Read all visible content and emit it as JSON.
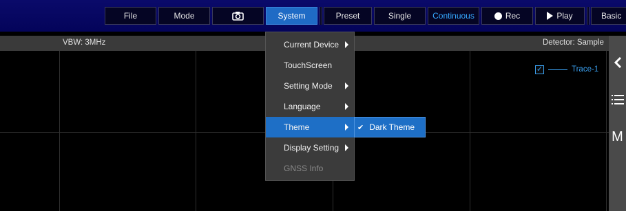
{
  "toolbar": {
    "file": "File",
    "mode": "Mode",
    "camera_icon": "camera-icon",
    "system": "System",
    "preset": "Preset",
    "single": "Single",
    "continuous": "Continuous",
    "rec": "Rec",
    "play": "Play",
    "basic": "Basic"
  },
  "status": {
    "vbw": "VBW: 3MHz",
    "detector": "Detector: Sample"
  },
  "legend": {
    "checked": true,
    "label": "Trace-1",
    "color": "#3aa0f0"
  },
  "menu": {
    "items": [
      {
        "label": "Current Device",
        "has_submenu": true
      },
      {
        "label": "TouchScreen",
        "has_submenu": false
      },
      {
        "label": "Setting Mode",
        "has_submenu": true
      },
      {
        "label": "Language",
        "has_submenu": true
      },
      {
        "label": "Theme",
        "has_submenu": true,
        "highlighted": true
      },
      {
        "label": "Display Setting",
        "has_submenu": true
      },
      {
        "label": "GNSS Info",
        "has_submenu": false,
        "disabled": true
      }
    ],
    "submenu": {
      "label": "Dark Theme",
      "checked": true
    }
  },
  "side": {
    "collapse_icon": "chevron-left-icon",
    "menu_icon": "list-icon",
    "marker_label": "M"
  },
  "colors": {
    "toolbar_bg": "#04045a",
    "accent": "#1e6fc6",
    "continuous_text": "#35a8ff"
  }
}
